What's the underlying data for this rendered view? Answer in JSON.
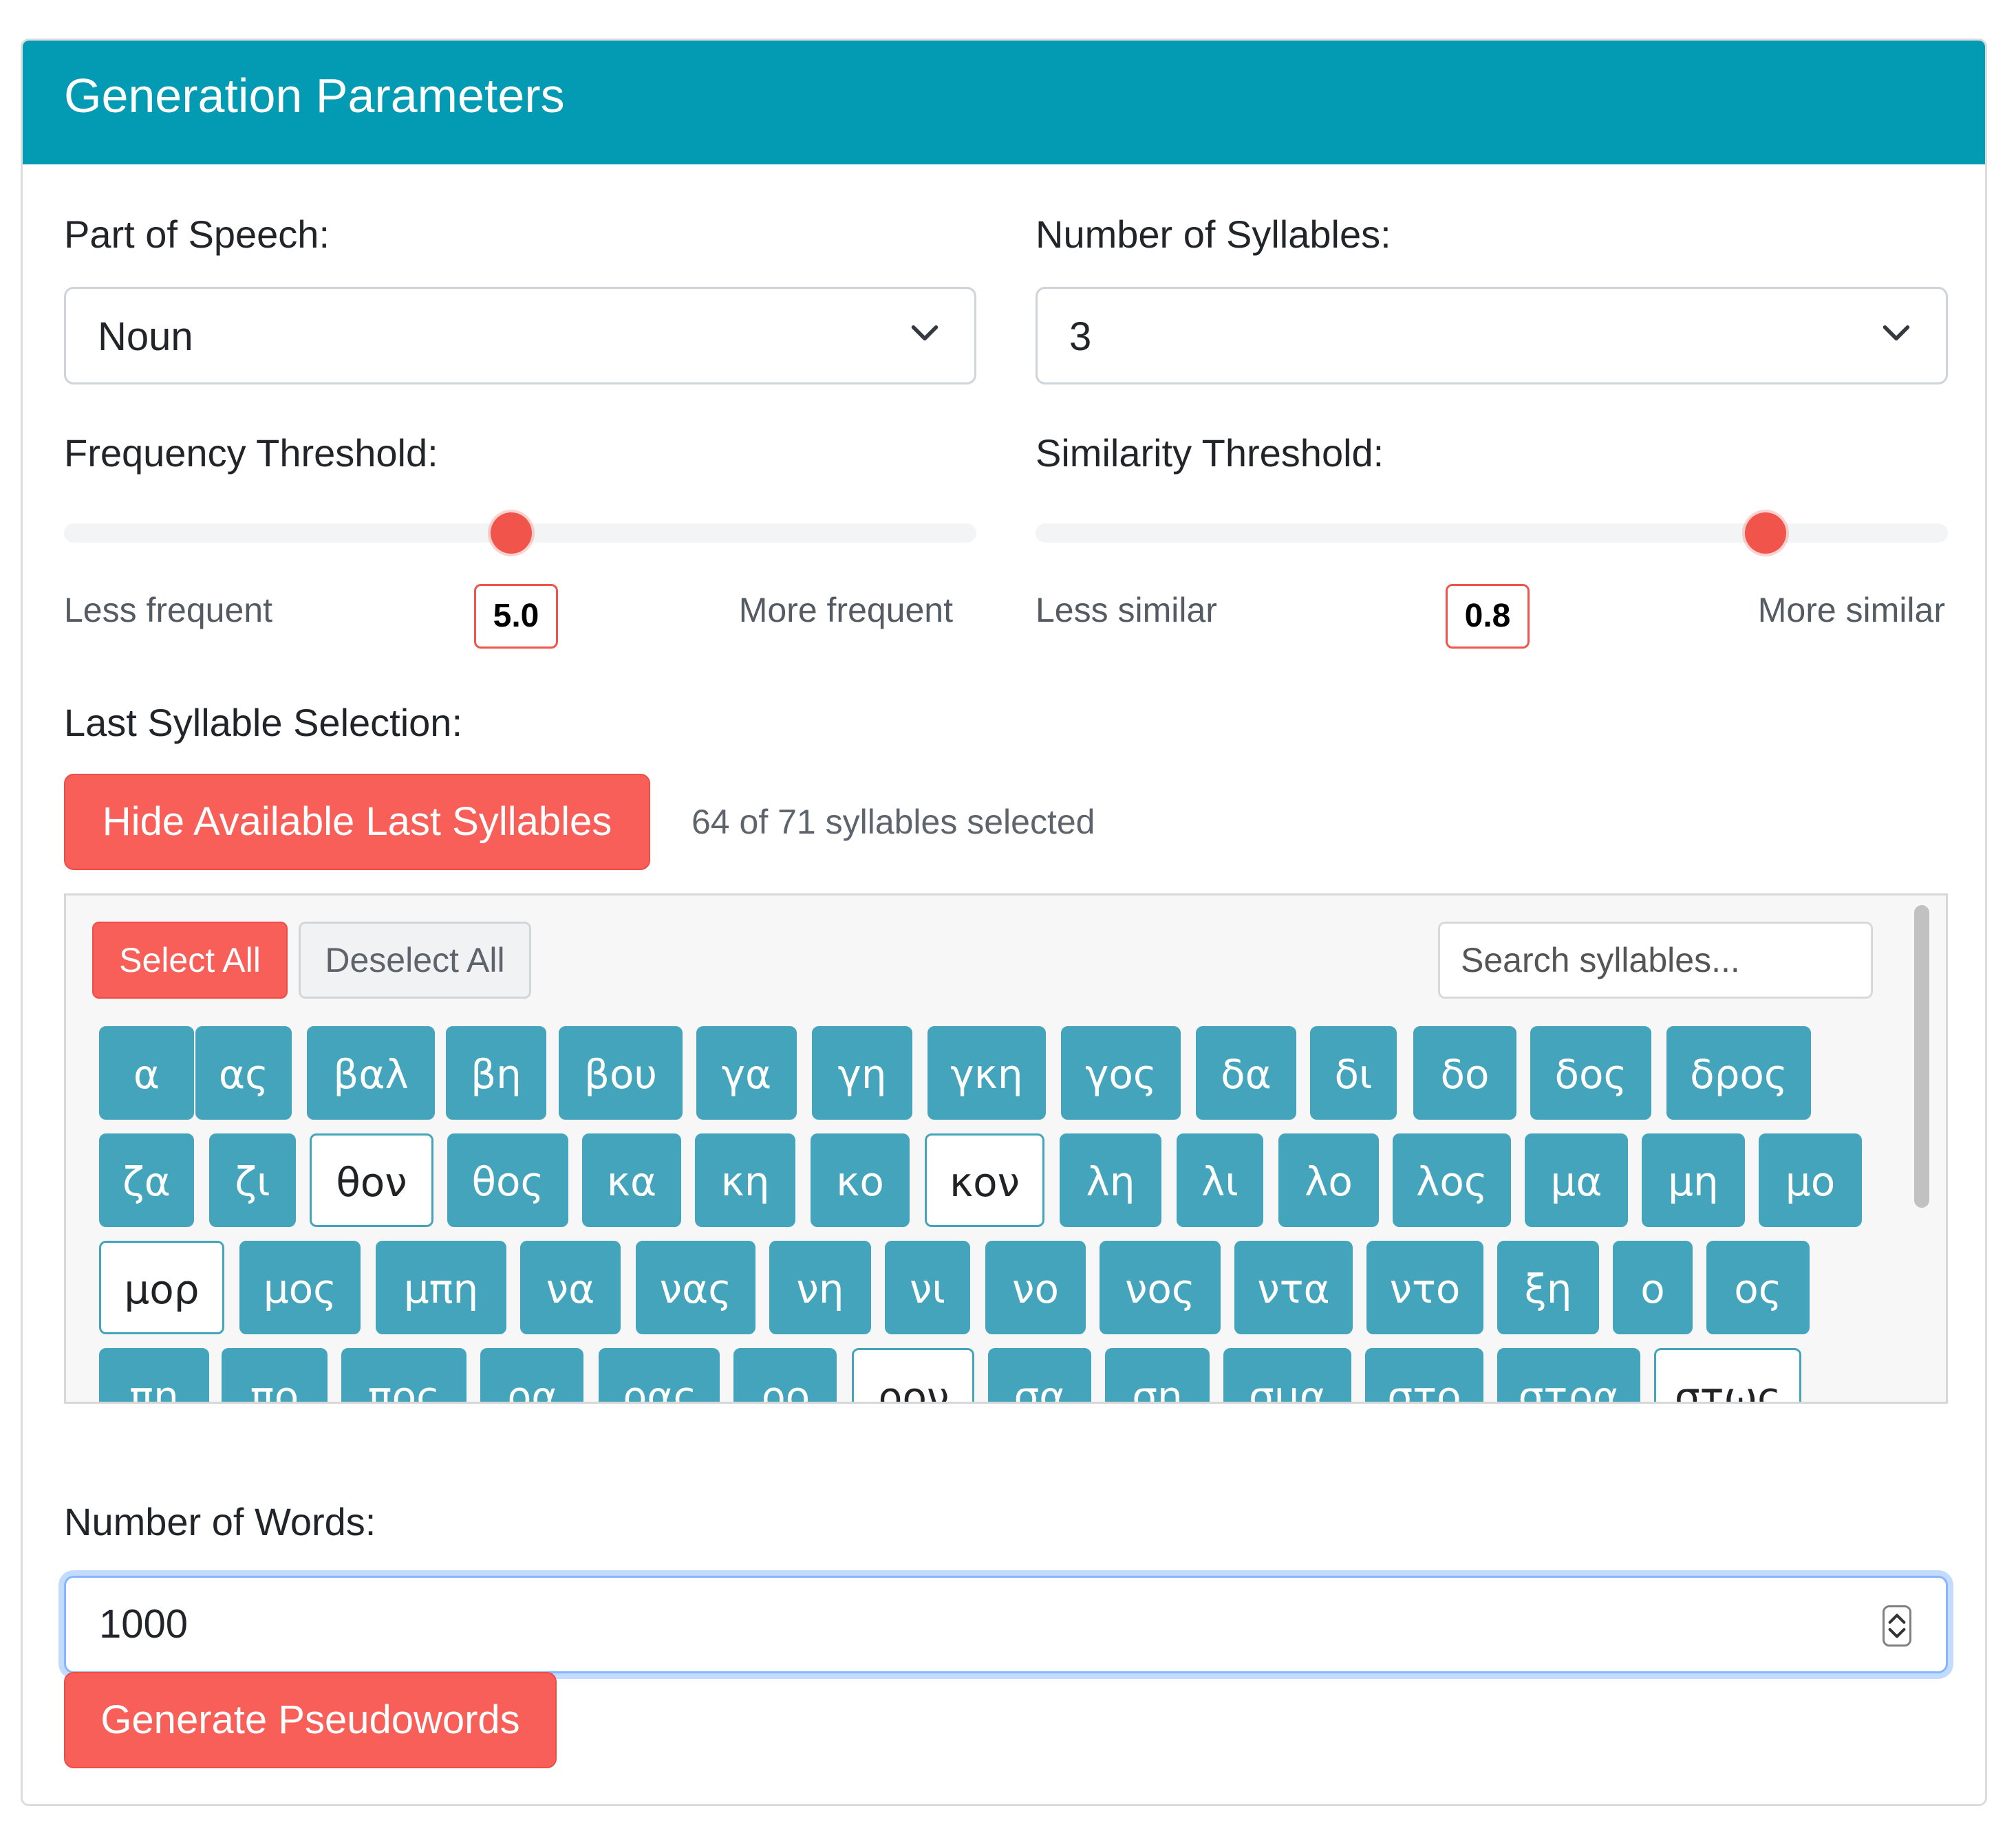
{
  "header": {
    "title": "Generation Parameters"
  },
  "part_of_speech": {
    "label": "Part of Speech:",
    "value": "Noun"
  },
  "syllables": {
    "label": "Number of Syllables:",
    "value": "3"
  },
  "frequency": {
    "label": "Frequency Threshold:",
    "min_label": "Less frequent",
    "max_label": "More frequent",
    "value": "5.0",
    "position_fraction": 0.49
  },
  "similarity": {
    "label": "Similarity Threshold:",
    "min_label": "Less similar",
    "max_label": "More similar",
    "value": "0.8",
    "position_fraction": 0.8
  },
  "last_syllable": {
    "label": "Last Syllable Selection:",
    "toggle_button": "Hide Available Last Syllables",
    "count_text": "64 of 71 syllables selected",
    "select_all": "Select All",
    "deselect_all": "Deselect All",
    "search_placeholder": "Search syllables...",
    "rows": [
      [
        {
          "text": "α",
          "selected": true
        },
        {
          "text": "ας",
          "selected": true
        },
        {
          "text": "βαλ",
          "selected": true
        },
        {
          "text": "βη",
          "selected": true
        },
        {
          "text": "βου",
          "selected": true
        },
        {
          "text": "γα",
          "selected": true
        },
        {
          "text": "γη",
          "selected": true
        },
        {
          "text": "γκη",
          "selected": true
        },
        {
          "text": "γος",
          "selected": true
        },
        {
          "text": "δα",
          "selected": true
        },
        {
          "text": "δι",
          "selected": true
        },
        {
          "text": "δο",
          "selected": true
        },
        {
          "text": "δος",
          "selected": true
        },
        {
          "text": "δρος",
          "selected": true
        }
      ],
      [
        {
          "text": "ζα",
          "selected": true
        },
        {
          "text": "ζι",
          "selected": true
        },
        {
          "text": "θον",
          "selected": false
        },
        {
          "text": "θος",
          "selected": true
        },
        {
          "text": "κα",
          "selected": true
        },
        {
          "text": "κη",
          "selected": true
        },
        {
          "text": "κο",
          "selected": true
        },
        {
          "text": "κον",
          "selected": false
        },
        {
          "text": "λη",
          "selected": true
        },
        {
          "text": "λι",
          "selected": true
        },
        {
          "text": "λο",
          "selected": true
        },
        {
          "text": "λος",
          "selected": true
        },
        {
          "text": "μα",
          "selected": true
        },
        {
          "text": "μη",
          "selected": true
        },
        {
          "text": "μο",
          "selected": true
        }
      ],
      [
        {
          "text": "μορ",
          "selected": false
        },
        {
          "text": "μος",
          "selected": true
        },
        {
          "text": "μπη",
          "selected": true
        },
        {
          "text": "να",
          "selected": true
        },
        {
          "text": "νας",
          "selected": true
        },
        {
          "text": "νη",
          "selected": true
        },
        {
          "text": "νι",
          "selected": true
        },
        {
          "text": "νο",
          "selected": true
        },
        {
          "text": "νος",
          "selected": true
        },
        {
          "text": "ντα",
          "selected": true
        },
        {
          "text": "ντο",
          "selected": true
        },
        {
          "text": "ξη",
          "selected": true
        },
        {
          "text": "ο",
          "selected": true
        },
        {
          "text": "ος",
          "selected": true
        }
      ],
      [
        {
          "text": "πη",
          "selected": true
        },
        {
          "text": "πο",
          "selected": true
        },
        {
          "text": "πος",
          "selected": true
        },
        {
          "text": "ρα",
          "selected": true
        },
        {
          "text": "ρας",
          "selected": true
        },
        {
          "text": "ρο",
          "selected": true
        },
        {
          "text": "ρον",
          "selected": false
        },
        {
          "text": "σα",
          "selected": true
        },
        {
          "text": "ση",
          "selected": true
        },
        {
          "text": "σμα",
          "selected": true
        },
        {
          "text": "στο",
          "selected": true
        },
        {
          "text": "στρα",
          "selected": true
        },
        {
          "text": "στως",
          "selected": false
        }
      ]
    ]
  },
  "words": {
    "label": "Number of Words:",
    "value": "1000"
  },
  "generate_button": "Generate Pseudowords",
  "colors": {
    "header_bg": "#039ab3",
    "accent_red": "#f85f58",
    "chip_teal": "#44a4bc"
  }
}
